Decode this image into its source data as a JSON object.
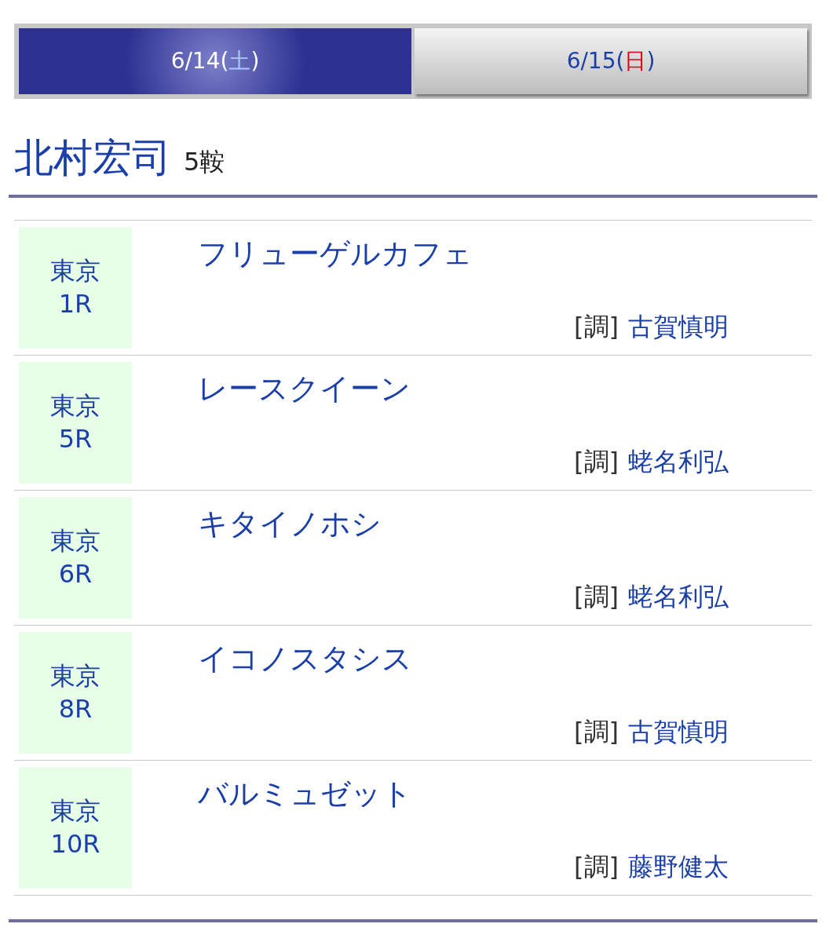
{
  "tabs": [
    {
      "date": "6/14(",
      "day": "土",
      "close": ")",
      "color": "#a9c8ff",
      "selected": true
    },
    {
      "date": "6/15(",
      "day": "日",
      "close": ")",
      "color": "#e0001b",
      "selected": false
    }
  ],
  "jockey": {
    "name": "北村宏司",
    "count": "5鞍"
  },
  "rides": [
    {
      "venue": "東京",
      "race": "1R",
      "horse": "フリューゲルカフェ",
      "trainer_label": "[調]",
      "trainer": "古賀慎明"
    },
    {
      "venue": "東京",
      "race": "5R",
      "horse": "レースクイーン",
      "trainer_label": "[調]",
      "trainer": "蛯名利弘"
    },
    {
      "venue": "東京",
      "race": "6R",
      "horse": "キタイノホシ",
      "trainer_label": "[調]",
      "trainer": "蛯名利弘"
    },
    {
      "venue": "東京",
      "race": "8R",
      "horse": "イコノスタシス",
      "trainer_label": "[調]",
      "trainer": "古賀慎明"
    },
    {
      "venue": "東京",
      "race": "10R",
      "horse": "バルミュゼット",
      "trainer_label": "[調]",
      "trainer": "藤野健太"
    }
  ]
}
